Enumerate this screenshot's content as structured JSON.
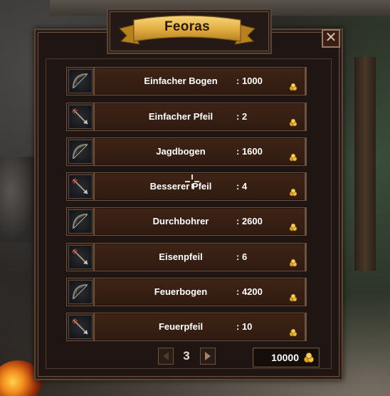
{
  "shop": {
    "title": "Feoras",
    "close_glyph": "✕",
    "items": [
      {
        "name": "Einfacher Bogen",
        "price": ": 1000",
        "icon": "bow-icon"
      },
      {
        "name": "Einfacher Pfeil",
        "price": ": 2",
        "icon": "arrow-icon"
      },
      {
        "name": "Jagdbogen",
        "price": ": 1600",
        "icon": "bow-icon"
      },
      {
        "name": "Besserer Pfeil",
        "price": ": 4",
        "icon": "arrow-icon"
      },
      {
        "name": "Durchbohrer",
        "price": ": 2600",
        "icon": "bow-icon"
      },
      {
        "name": "Eisenpfeil",
        "price": ": 6",
        "icon": "arrow-icon"
      },
      {
        "name": "Feuerbogen",
        "price": ": 4200",
        "icon": "bow-icon"
      },
      {
        "name": "Feuerpfeil",
        "price": ": 10",
        "icon": "arrow-icon"
      }
    ],
    "pager": {
      "page": "3"
    },
    "gold": "10000",
    "colors": {
      "banner": "#e8b84a",
      "frame": "#6b523f",
      "row": "#3a2214",
      "text": "#ffffff"
    }
  }
}
